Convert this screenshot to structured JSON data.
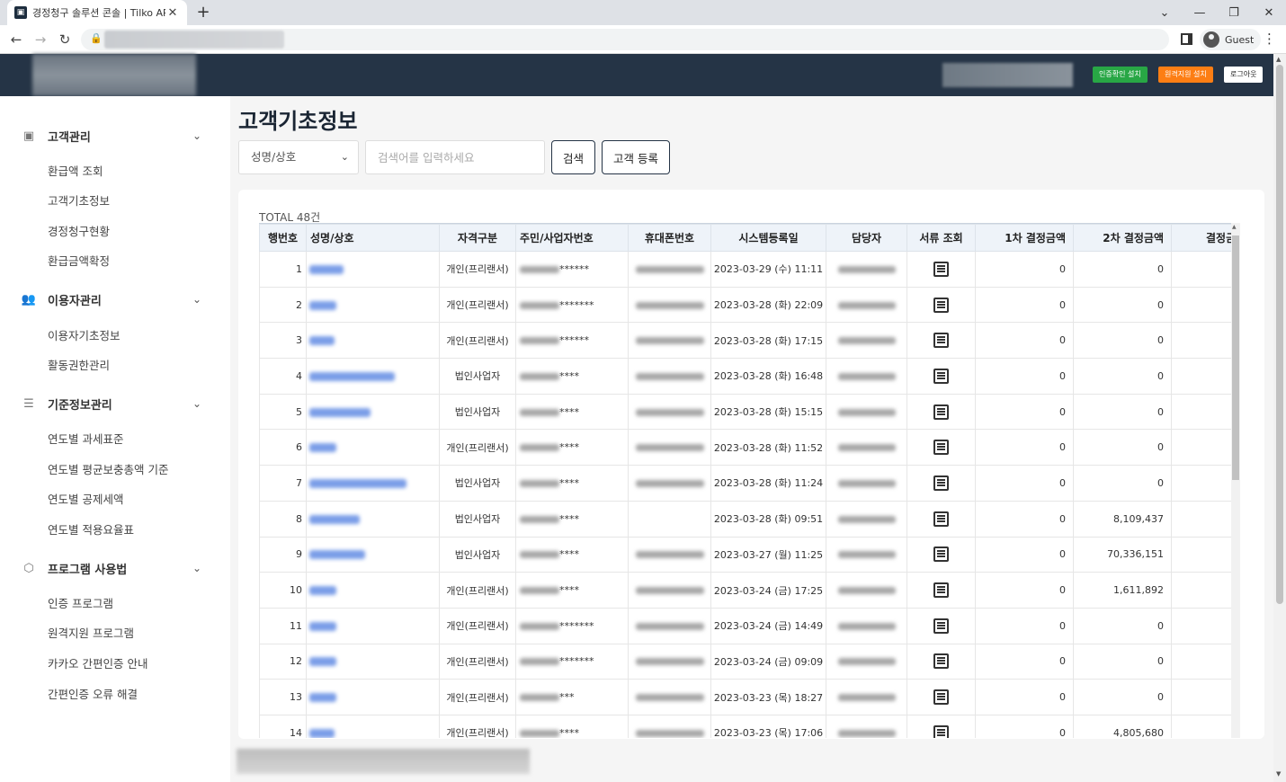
{
  "browser": {
    "tab_title": "경정청구 솔루션 콘솔 | Tilko API",
    "tab_close": "✕",
    "new_tab": "+",
    "profile_label": "Guest"
  },
  "header": {
    "btn_cert_install": "인증확인 설치",
    "btn_remote_install": "원격지원 설치",
    "btn_logout": "로그아웃"
  },
  "sidebar": {
    "sections": [
      {
        "label": "고객관리",
        "icon": "person-badge-icon",
        "items": [
          "환급액 조회",
          "고객기초정보",
          "경정청구현황",
          "환급금액확정"
        ]
      },
      {
        "label": "이용자관리",
        "icon": "users-icon",
        "items": [
          "이용자기초정보",
          "활동권한관리"
        ]
      },
      {
        "label": "기준정보관리",
        "icon": "list-icon",
        "items": [
          "연도별 과세표준",
          "연도별 평균보충총액 기준",
          "연도별 공제세액",
          "연도별 적용요율표"
        ]
      },
      {
        "label": "프로그램 사용법",
        "icon": "cube-icon",
        "items": [
          "인증 프로그램",
          "원격지원 프로그램",
          "카카오 간편인증 안내",
          "간편인증 오류 해결"
        ]
      }
    ]
  },
  "page": {
    "title": "고객기초정보",
    "search_select_value": "성명/상호",
    "search_placeholder": "검색어를 입력하세요",
    "search_button": "검색",
    "register_button": "고객 등록",
    "total_label": "TOTAL 48건"
  },
  "table": {
    "columns": [
      "행번호",
      "성명/상호",
      "자격구분",
      "주민/사업자번호",
      "휴대폰번호",
      "시스템등록일",
      "담당자",
      "서류 조회",
      "1차 결정금액",
      "2차 결정금액",
      "결정금액"
    ],
    "rows": [
      {
        "no": "1",
        "type": "개인(프리랜서)",
        "id_suffix": "******",
        "date": "2023-03-29 (수) 11:11",
        "amt1": "0",
        "amt2": "0"
      },
      {
        "no": "2",
        "type": "개인(프리랜서)",
        "id_suffix": "*******",
        "date": "2023-03-28 (화) 22:09",
        "amt1": "0",
        "amt2": "0"
      },
      {
        "no": "3",
        "type": "개인(프리랜서)",
        "id_suffix": "******",
        "date": "2023-03-28 (화) 17:15",
        "amt1": "0",
        "amt2": "0"
      },
      {
        "no": "4",
        "type": "법인사업자",
        "id_suffix": "****",
        "date": "2023-03-28 (화) 16:48",
        "amt1": "0",
        "amt2": "0"
      },
      {
        "no": "5",
        "type": "법인사업자",
        "id_suffix": "****",
        "date": "2023-03-28 (화) 15:15",
        "amt1": "0",
        "amt2": "0"
      },
      {
        "no": "6",
        "type": "개인(프리랜서)",
        "id_suffix": "****",
        "date": "2023-03-28 (화) 11:52",
        "amt1": "0",
        "amt2": "0"
      },
      {
        "no": "7",
        "type": "법인사업자",
        "id_suffix": "****",
        "date": "2023-03-28 (화) 11:24",
        "amt1": "0",
        "amt2": "0"
      },
      {
        "no": "8",
        "type": "법인사업자",
        "id_suffix": "****",
        "date": "2023-03-28 (화) 09:51",
        "amt1": "0",
        "amt2": "8,109,437"
      },
      {
        "no": "9",
        "type": "법인사업자",
        "id_suffix": "****",
        "date": "2023-03-27 (월) 11:25",
        "amt1": "0",
        "amt2": "70,336,151"
      },
      {
        "no": "10",
        "type": "개인(프리랜서)",
        "id_suffix": "****",
        "date": "2023-03-24 (금) 17:25",
        "amt1": "0",
        "amt2": "1,611,892"
      },
      {
        "no": "11",
        "type": "개인(프리랜서)",
        "id_suffix": "*******",
        "date": "2023-03-24 (금) 14:49",
        "amt1": "0",
        "amt2": "0"
      },
      {
        "no": "12",
        "type": "개인(프리랜서)",
        "id_suffix": "*******",
        "date": "2023-03-24 (금) 09:09",
        "amt1": "0",
        "amt2": "0"
      },
      {
        "no": "13",
        "type": "개인(프리랜서)",
        "id_suffix": "***",
        "date": "2023-03-23 (목) 18:27",
        "amt1": "0",
        "amt2": "0"
      },
      {
        "no": "14",
        "type": "개인(프리랜서)",
        "id_suffix": "****",
        "date": "2023-03-23 (목) 17:06",
        "amt1": "0",
        "amt2": "4,805,680"
      }
    ]
  },
  "colors": {
    "header_bg": "#253446",
    "btn_green": "#28a745",
    "btn_orange": "#fd7e14",
    "link_blue": "#7b9ee8",
    "table_header_bg": "#eef3f9"
  }
}
